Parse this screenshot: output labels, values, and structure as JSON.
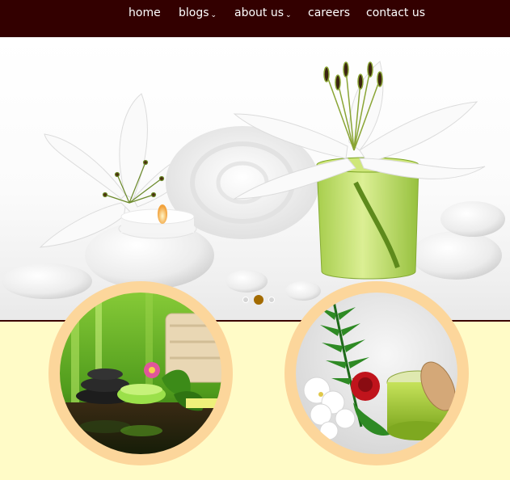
{
  "nav": {
    "items": [
      {
        "label": "home",
        "has_dropdown": false
      },
      {
        "label": "blogs",
        "has_dropdown": true
      },
      {
        "label": "about us",
        "has_dropdown": true
      },
      {
        "label": "careers",
        "has_dropdown": false
      },
      {
        "label": "contact us",
        "has_dropdown": false
      }
    ],
    "caret_glyph": "⌄"
  },
  "slider": {
    "slide_count": 3,
    "active_slide_index": 2
  },
  "colors": {
    "nav_bg": "#330000",
    "page_bg": "#fffbc7",
    "circle_border": "#fcd69b",
    "active_dot": "#a36b00"
  }
}
